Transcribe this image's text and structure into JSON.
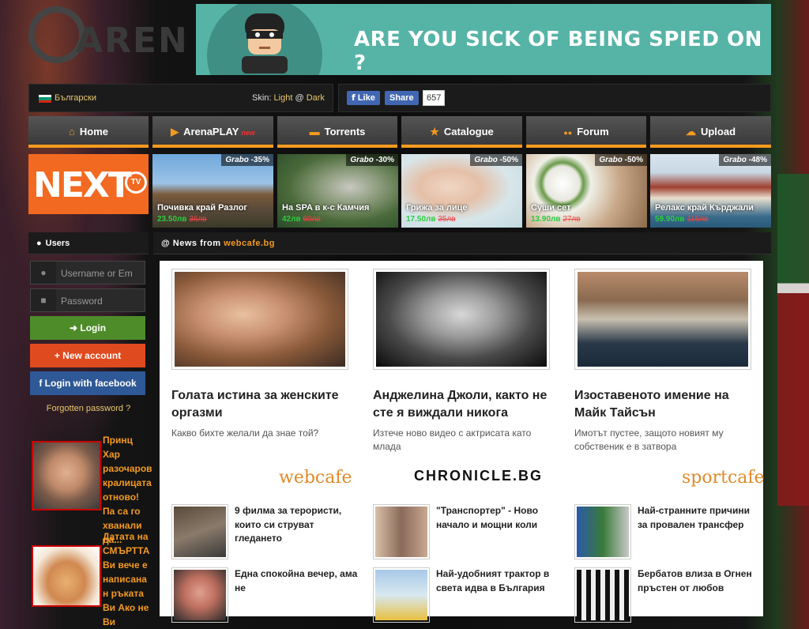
{
  "logo": {
    "text": "AREN"
  },
  "banner": {
    "message": "ARE YOU SICK OF BEING SPIED ON ?"
  },
  "topbar": {
    "language": "Български",
    "skin_label": "Skin:",
    "skin_light": "Light",
    "skin_sep": "@",
    "skin_dark": "Dark"
  },
  "social": {
    "like": "Like",
    "share": "Share",
    "count": "657"
  },
  "nav": [
    {
      "label": "Home",
      "icon": "home-icon",
      "glyph": "⌂"
    },
    {
      "label": "ArenaPLAY",
      "icon": "play-icon",
      "glyph": "▶",
      "badge": "new"
    },
    {
      "label": "Torrents",
      "icon": "folder-icon",
      "glyph": "▬"
    },
    {
      "label": "Catalogue",
      "icon": "star-icon",
      "glyph": "★"
    },
    {
      "label": "Forum",
      "icon": "users-icon",
      "glyph": "●●"
    },
    {
      "label": "Upload",
      "icon": "cloud-upload-icon",
      "glyph": "☁"
    }
  ],
  "next_tv": {
    "text": "NEXT",
    "tv": "TV"
  },
  "deals": [
    {
      "brand": "Grabo",
      "discount": "-35%",
      "title": "Почивка край Разлог",
      "new_price": "23.50лв",
      "old_price": "36лв"
    },
    {
      "brand": "Grabo",
      "discount": "-30%",
      "title": "На SPA в к-с Камчия",
      "new_price": "42лв",
      "old_price": "60лв"
    },
    {
      "brand": "Grabo",
      "discount": "-50%",
      "title": "Грижа за лице",
      "new_price": "17.50лв",
      "old_price": "35лв"
    },
    {
      "brand": "Grabo",
      "discount": "-50%",
      "title": "Суши сет",
      "new_price": "13.90лв",
      "old_price": "27лв"
    },
    {
      "brand": "Grabo",
      "discount": "-48%",
      "title": "Релакс край Кърджали",
      "new_price": "59.90лв",
      "old_price": "115лв"
    }
  ],
  "users": {
    "heading": "Users",
    "username_placeholder": "Username or Em",
    "password_placeholder": "Password",
    "login": "Login",
    "new_account": "New account",
    "facebook_login": "Login with facebook",
    "forgot": "Forgotten password ?"
  },
  "side_news": [
    {
      "title": "Принц Хар разочаров кралицата отново! Па са го хванали да..."
    },
    {
      "title": "Датата на СМЪРТТА Ви вече е написана н ръката Ви Ако не Ви"
    }
  ],
  "news": {
    "prefix": "@ News from",
    "source": "webcafe.bg",
    "columns": [
      {
        "title": "Голата истина за женските оргазми",
        "subtitle": "Какво бихте желали да знае той?",
        "brand": "webcafe",
        "items": [
          {
            "title": "9 филма за терористи, които си струват гледането"
          },
          {
            "title": "Една спокойна вечер, ама не"
          }
        ]
      },
      {
        "title": "Анджелина Джоли, както не сте я виждали никога",
        "subtitle": "Изтече ново видео с актрисата като млада",
        "brand": "CHRONICLE.BG",
        "items": [
          {
            "title": "\"Транспортер\" - Ново начало и мощни коли"
          },
          {
            "title": "Най-удобният трактор в света идва в България"
          }
        ]
      },
      {
        "title": "Изоставеното имение на Майк Тайсън",
        "subtitle": "Имотът пустее, защото новият му собственик е в затвора",
        "brand": "sportcafe",
        "items": [
          {
            "title": "Най-странните причини за провален трансфер"
          },
          {
            "title": "Бербатов влиза в Огнен пръстен от любов"
          }
        ]
      }
    ]
  }
}
